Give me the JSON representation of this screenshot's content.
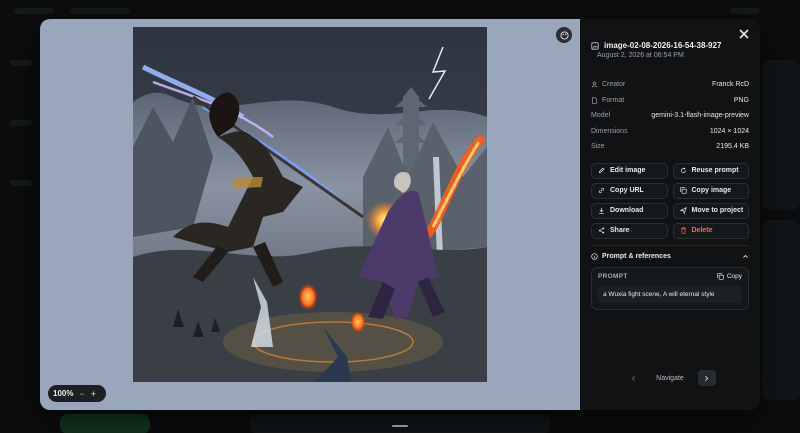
{
  "file": {
    "name": "image-02-08-2026-16-54-38-927",
    "date": "August 2, 2026 at 06:54 PM"
  },
  "meta": [
    {
      "key": "Creator",
      "value": "Franck RcD",
      "icon": "user-icon"
    },
    {
      "key": "Format",
      "value": "PNG",
      "icon": "file-icon"
    },
    {
      "key": "Model",
      "value": "gemini-3.1-flash-image-preview",
      "icon": ""
    },
    {
      "key": "Dimensions",
      "value": "1024 × 1024",
      "icon": ""
    },
    {
      "key": "Size",
      "value": "2195.4 KB",
      "icon": ""
    }
  ],
  "actions": {
    "edit": "Edit image",
    "reuse": "Reuse prompt",
    "copy_url": "Copy URL",
    "copy_image": "Copy image",
    "download": "Download",
    "move": "Move to project",
    "share": "Share",
    "delete": "Delete"
  },
  "prompt": {
    "section_title": "Prompt & references",
    "label": "PROMPT",
    "copy_label": "Copy",
    "text": "a Wuxia fight scene, A will eternal style"
  },
  "zoom": {
    "value": "100%",
    "minus": "−",
    "plus": "+"
  },
  "nav": {
    "label": "Navigate"
  },
  "colors": {
    "viewer_bg": "#9aa6bc",
    "panel_bg": "#101214",
    "danger": "#f06a5a"
  }
}
